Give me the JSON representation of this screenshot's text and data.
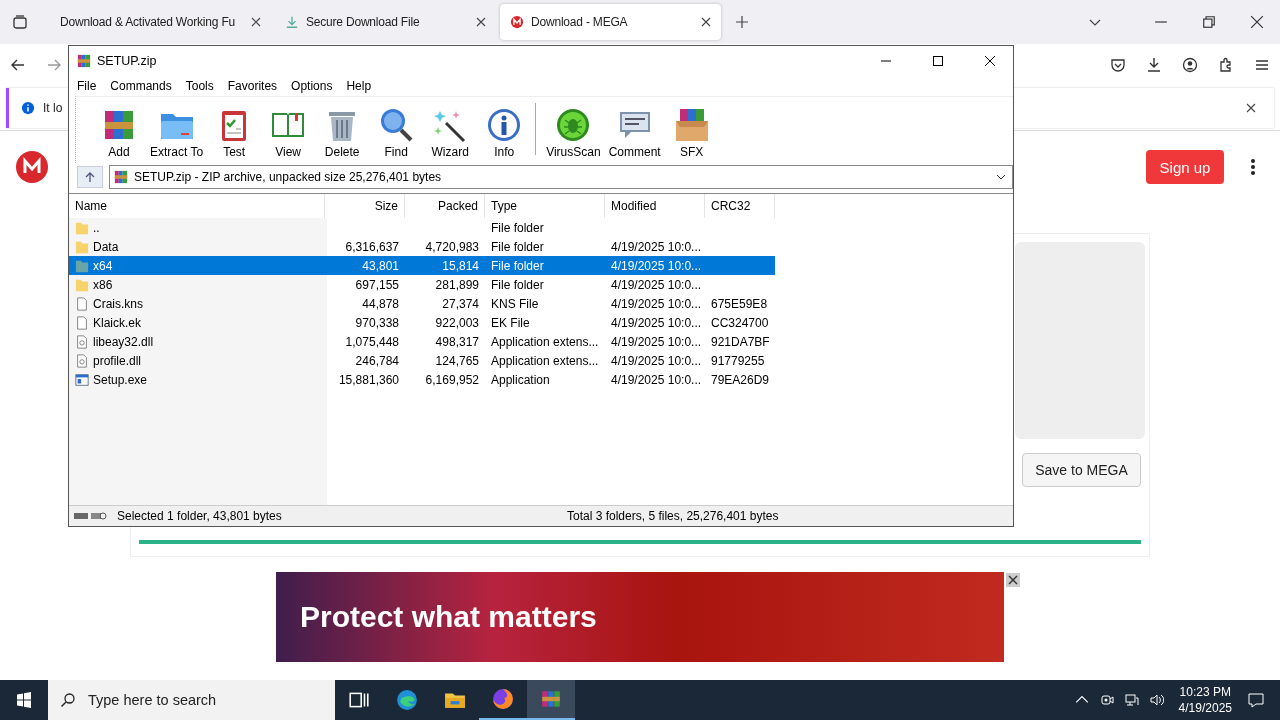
{
  "browser": {
    "tabs": [
      {
        "title": "Download & Activated Working Fu",
        "selected": false
      },
      {
        "title": "Secure Download File",
        "selected": false
      },
      {
        "title": "Download - MEGA",
        "selected": true
      }
    ],
    "notification": {
      "text": "It lo"
    }
  },
  "page": {
    "sign_up": "Sign up",
    "save_button": "Save to MEGA",
    "progress": {
      "level": 1
    },
    "ad": {
      "headline": "Protect what matters"
    }
  },
  "winrar": {
    "title": "SETUP.zip",
    "menu": [
      "File",
      "Commands",
      "Tools",
      "Favorites",
      "Options",
      "Help"
    ],
    "toolbar": [
      [
        "Add",
        "Extract To",
        "Test",
        "View",
        "Delete",
        "Find",
        "Wizard",
        "Info"
      ],
      [
        "VirusScan",
        "Comment",
        "SFX"
      ]
    ],
    "address": "SETUP.zip - ZIP archive, unpacked size 25,276,401 bytes",
    "columns": [
      "Name",
      "Size",
      "Packed",
      "Type",
      "Modified",
      "CRC32"
    ],
    "rows": [
      {
        "kind": "folder",
        "selected": false,
        "cells": [
          "..",
          "",
          "",
          "File folder",
          "",
          ""
        ]
      },
      {
        "kind": "folder",
        "selected": false,
        "cells": [
          "Data",
          "6,316,637",
          "4,720,983",
          "File folder",
          "4/19/2025 10:0...",
          ""
        ]
      },
      {
        "kind": "folder",
        "selected": true,
        "cells": [
          "x64",
          "43,801",
          "15,814",
          "File folder",
          "4/19/2025 10:0...",
          ""
        ]
      },
      {
        "kind": "folder",
        "selected": false,
        "cells": [
          "x86",
          "697,155",
          "281,899",
          "File folder",
          "4/19/2025 10:0...",
          ""
        ]
      },
      {
        "kind": "file",
        "selected": false,
        "cells": [
          "Crais.kns",
          "44,878",
          "27,374",
          "KNS File",
          "4/19/2025 10:0...",
          "675E59E8"
        ]
      },
      {
        "kind": "file",
        "selected": false,
        "cells": [
          "Klaick.ek",
          "970,338",
          "922,003",
          "EK File",
          "4/19/2025 10:0...",
          "CC324700"
        ]
      },
      {
        "kind": "dll",
        "selected": false,
        "cells": [
          "libeay32.dll",
          "1,075,448",
          "498,317",
          "Application extens...",
          "4/19/2025 10:0...",
          "921DA7BF"
        ]
      },
      {
        "kind": "dll",
        "selected": false,
        "cells": [
          "profile.dll",
          "246,784",
          "124,765",
          "Application extens...",
          "4/19/2025 10:0...",
          "91779255"
        ]
      },
      {
        "kind": "exe",
        "selected": false,
        "cells": [
          "Setup.exe",
          "15,881,360",
          "6,169,952",
          "Application",
          "4/19/2025 10:0...",
          "79EA26D9"
        ]
      }
    ],
    "status_left": "Selected 1 folder, 43,801 bytes",
    "status_right": "Total 3 folders, 5 files, 25,276,401 bytes"
  },
  "taskbar": {
    "search": {
      "placeholder": "Type here to search"
    },
    "apps": [
      {
        "selected": false,
        "running": false
      },
      {
        "selected": false,
        "running": false
      },
      {
        "selected": false,
        "running": false
      },
      {
        "selected": false,
        "running": true
      },
      {
        "selected": true,
        "running": true
      }
    ],
    "time": "10:23 PM",
    "date": "4/19/2025"
  }
}
